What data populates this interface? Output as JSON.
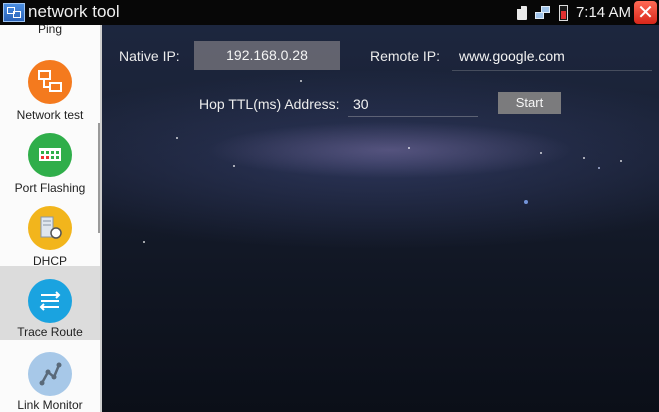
{
  "app": {
    "title": "network tool"
  },
  "status_bar": {
    "time": "7:14 AM"
  },
  "sidebar": {
    "items": [
      {
        "label": "Ping",
        "color": "#f0a020"
      },
      {
        "label": "Network test",
        "color": "#f47a1e"
      },
      {
        "label": "Port Flashing",
        "color": "#2fae4a"
      },
      {
        "label": "DHCP",
        "color": "#f2b51c"
      },
      {
        "label": "Trace Route",
        "color": "#1aa3e0"
      },
      {
        "label": "Link Monitor",
        "color": "#a7c8e8"
      }
    ],
    "active_index": 4
  },
  "form": {
    "native_ip_label": "Native IP:",
    "native_ip_value": "192.168.0.28",
    "remote_ip_label": "Remote IP:",
    "remote_ip_value": "www.google.com",
    "ttl_label": "Hop TTL(ms) Address:",
    "ttl_value": "30",
    "start_label": "Start"
  }
}
